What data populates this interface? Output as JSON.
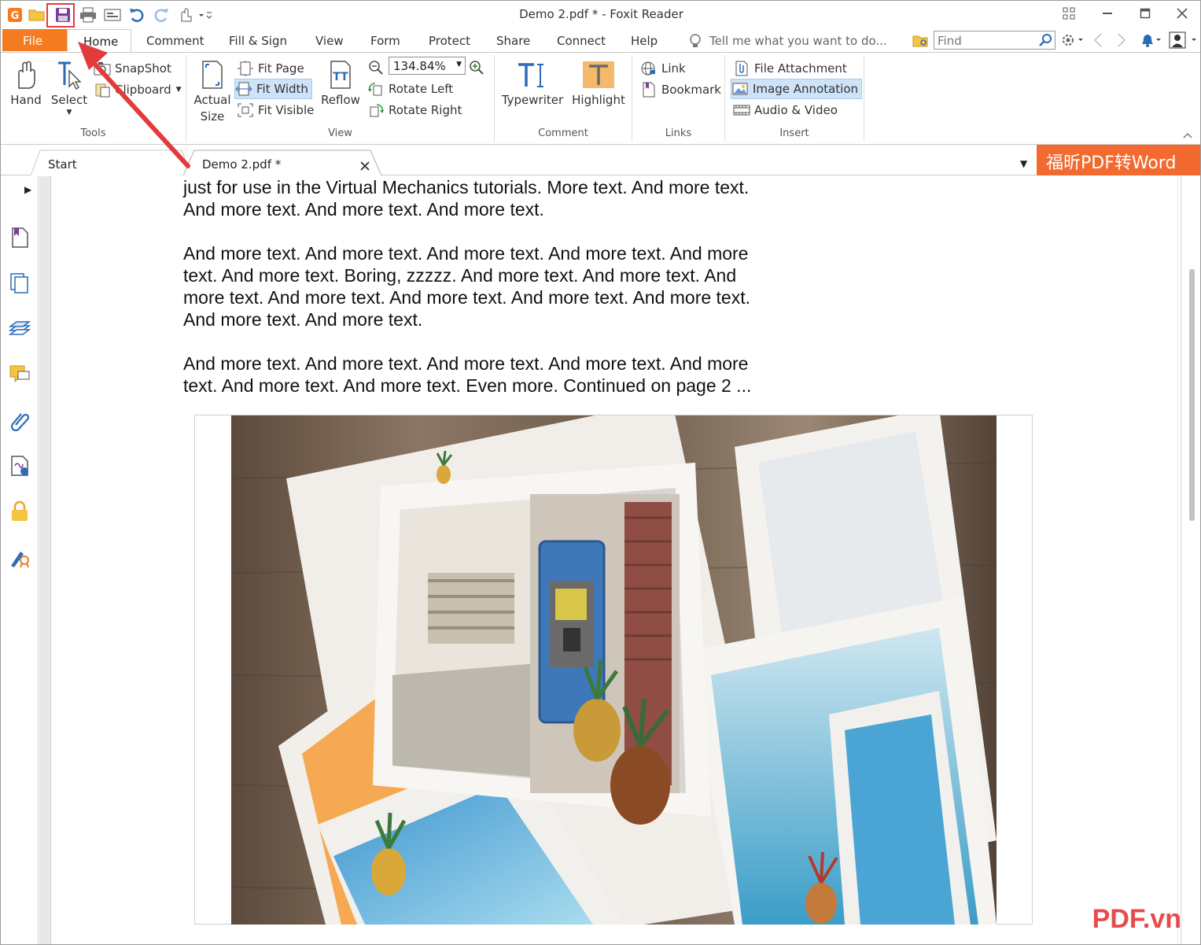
{
  "window": {
    "title": "Demo 2.pdf * - Foxit Reader"
  },
  "menu": {
    "file": "File",
    "tabs": [
      "Home",
      "Comment",
      "Fill & Sign",
      "View",
      "Form",
      "Protect",
      "Share",
      "Connect",
      "Help"
    ],
    "tell_me": "Tell me what you want to do...",
    "find_placeholder": "Find"
  },
  "ribbon": {
    "tools": {
      "label": "Tools",
      "hand": "Hand",
      "select": "Select",
      "snapshot": "SnapShot",
      "clipboard": "Clipboard"
    },
    "view": {
      "label": "View",
      "actual_size": "Actual Size",
      "fit_page": "Fit Page",
      "fit_width": "Fit Width",
      "fit_visible": "Fit Visible",
      "reflow": "Reflow",
      "zoom": "134.84%",
      "rotate_left": "Rotate Left",
      "rotate_right": "Rotate Right"
    },
    "comment": {
      "label": "Comment",
      "typewriter": "Typewriter",
      "highlight": "Highlight"
    },
    "links": {
      "label": "Links",
      "link": "Link",
      "bookmark": "Bookmark"
    },
    "insert": {
      "label": "Insert",
      "file_attachment": "File Attachment",
      "image_annotation": "Image Annotation",
      "audio_video": "Audio & Video"
    }
  },
  "tabs": {
    "start": "Start",
    "document": "Demo 2.pdf *"
  },
  "promo": "福昕PDF转Word",
  "document": {
    "paragraphs": [
      "just for use in the Virtual Mechanics tutorials. More text. And more text. And more text. And more text. And more text.",
      "And more text. And more text. And more text. And more text. And more text. And more text. Boring, zzzzz. And more text. And more text. And more text. And more text. And more text. And more text. And more text. And more text. And more text.",
      "And more text. And more text. And more text. And more text. And more text. And more text. And more text. Even more. Continued on page 2 ..."
    ]
  },
  "watermark": "PDF.vn",
  "colors": {
    "accent": "#f47b20",
    "highlight_box": "#e33b3b",
    "promo": "#f26a30",
    "selected": "#cde3f7"
  }
}
